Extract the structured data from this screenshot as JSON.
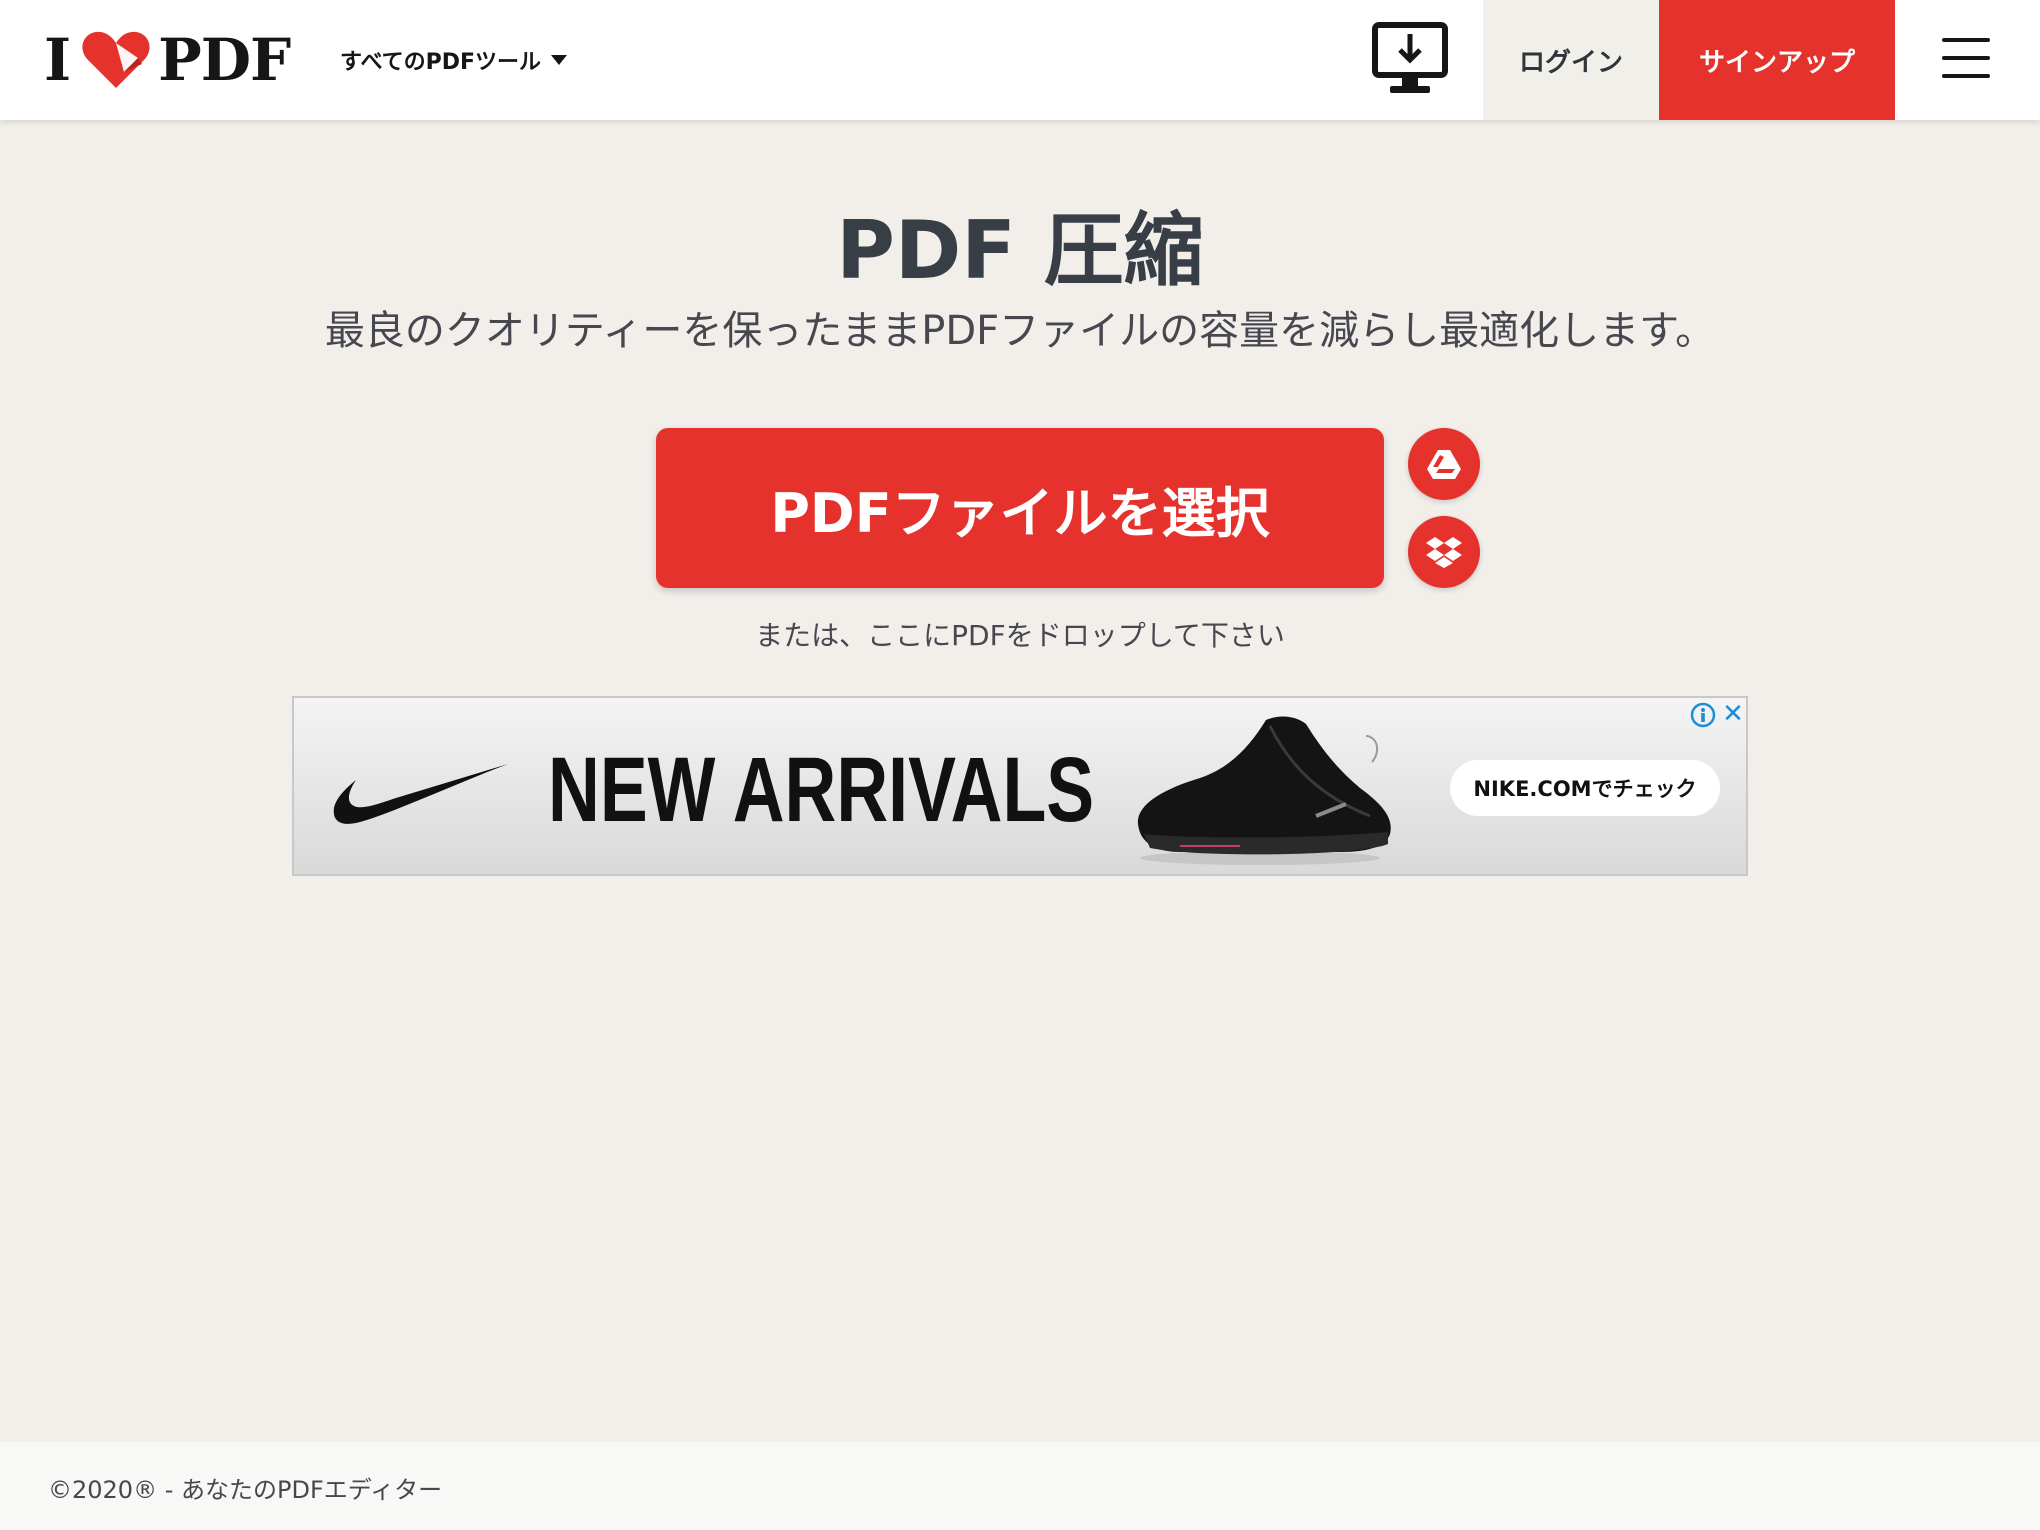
{
  "header": {
    "logo_prefix": "I",
    "logo_suffix": "PDF",
    "tools_menu_label": "すべてのPDFツール",
    "login_label": "ログイン",
    "signup_label": "サインアップ",
    "icons": [
      "heart-logo-icon",
      "chevron-down-icon",
      "desktop-download-icon",
      "hamburger-menu-icon"
    ]
  },
  "main": {
    "title": "PDF 圧縮",
    "subtitle": "最良のクオリティーを保ったままPDFファイルの容量を減らし最適化します。",
    "select_button_label": "PDFファイルを選択",
    "drop_hint": "または、ここにPDFをドロップして下さい",
    "cloud_icons": [
      "google-drive-icon",
      "dropbox-icon"
    ]
  },
  "ad": {
    "headline": "NEW ARRIVALS",
    "cta_label": "NIKE.COMでチェック",
    "close_glyph": "✕",
    "icons": [
      "nike-swoosh-icon",
      "sneaker-image",
      "ad-info-icon",
      "close-icon"
    ]
  },
  "footer": {
    "copyright": "©2020® - あなたのPDFエディター"
  },
  "colors": {
    "brand_red": "#e5322d",
    "page_background": "#f2efeb",
    "text_dark": "#383e45"
  }
}
